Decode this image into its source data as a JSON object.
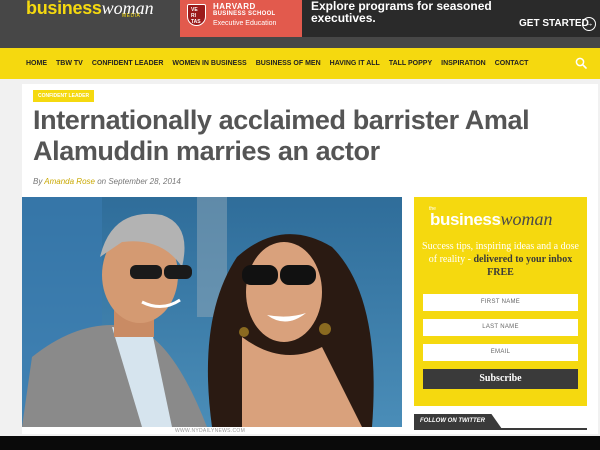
{
  "site": {
    "logo_business": "business",
    "logo_woman": "woman",
    "logo_media": "MEDIA"
  },
  "ad": {
    "school_line1": "HARVARD",
    "school_line2": "BUSINESS SCHOOL",
    "school_line3": "Executive Education",
    "text": "Explore programs for seasoned executives.",
    "cta": "GET STARTED",
    "cta_icon": "arrow-right-circle-icon"
  },
  "nav": {
    "items": [
      "HOME",
      "TBW TV",
      "CONFIDENT LEADER",
      "WOMEN IN BUSINESS",
      "BUSINESS OF MEN",
      "HAVING IT ALL",
      "TALL POPPY",
      "INSPIRATION",
      "CONTACT"
    ],
    "search_icon": "search-icon"
  },
  "article": {
    "category": "CONFIDENT LEADER",
    "title": "Internationally acclaimed barrister Amal Alamuddin marries an actor",
    "byline_by": "By ",
    "author": "Amanda Rose",
    "byline_on": " on September 28, 2014",
    "photo_credit": "WWW.NYDAILYNEWS.COM"
  },
  "sidebar": {
    "logo_the": "the",
    "logo_business": "business",
    "logo_woman": "woman",
    "pitch_plain": "Success tips, inspiring ideas and a dose of reality - ",
    "pitch_bold": "delivered to your inbox FREE",
    "first_name_placeholder": "FIRST NAME",
    "last_name_placeholder": "LAST NAME",
    "email_placeholder": "EMAIL",
    "subscribe_label": "Subscribe",
    "follow_label": "FOLLOW ON TWITTER"
  },
  "colors": {
    "brand_yellow": "#f5d90f",
    "topbar_gray": "#474747",
    "harvard_red": "#e25a4d"
  }
}
